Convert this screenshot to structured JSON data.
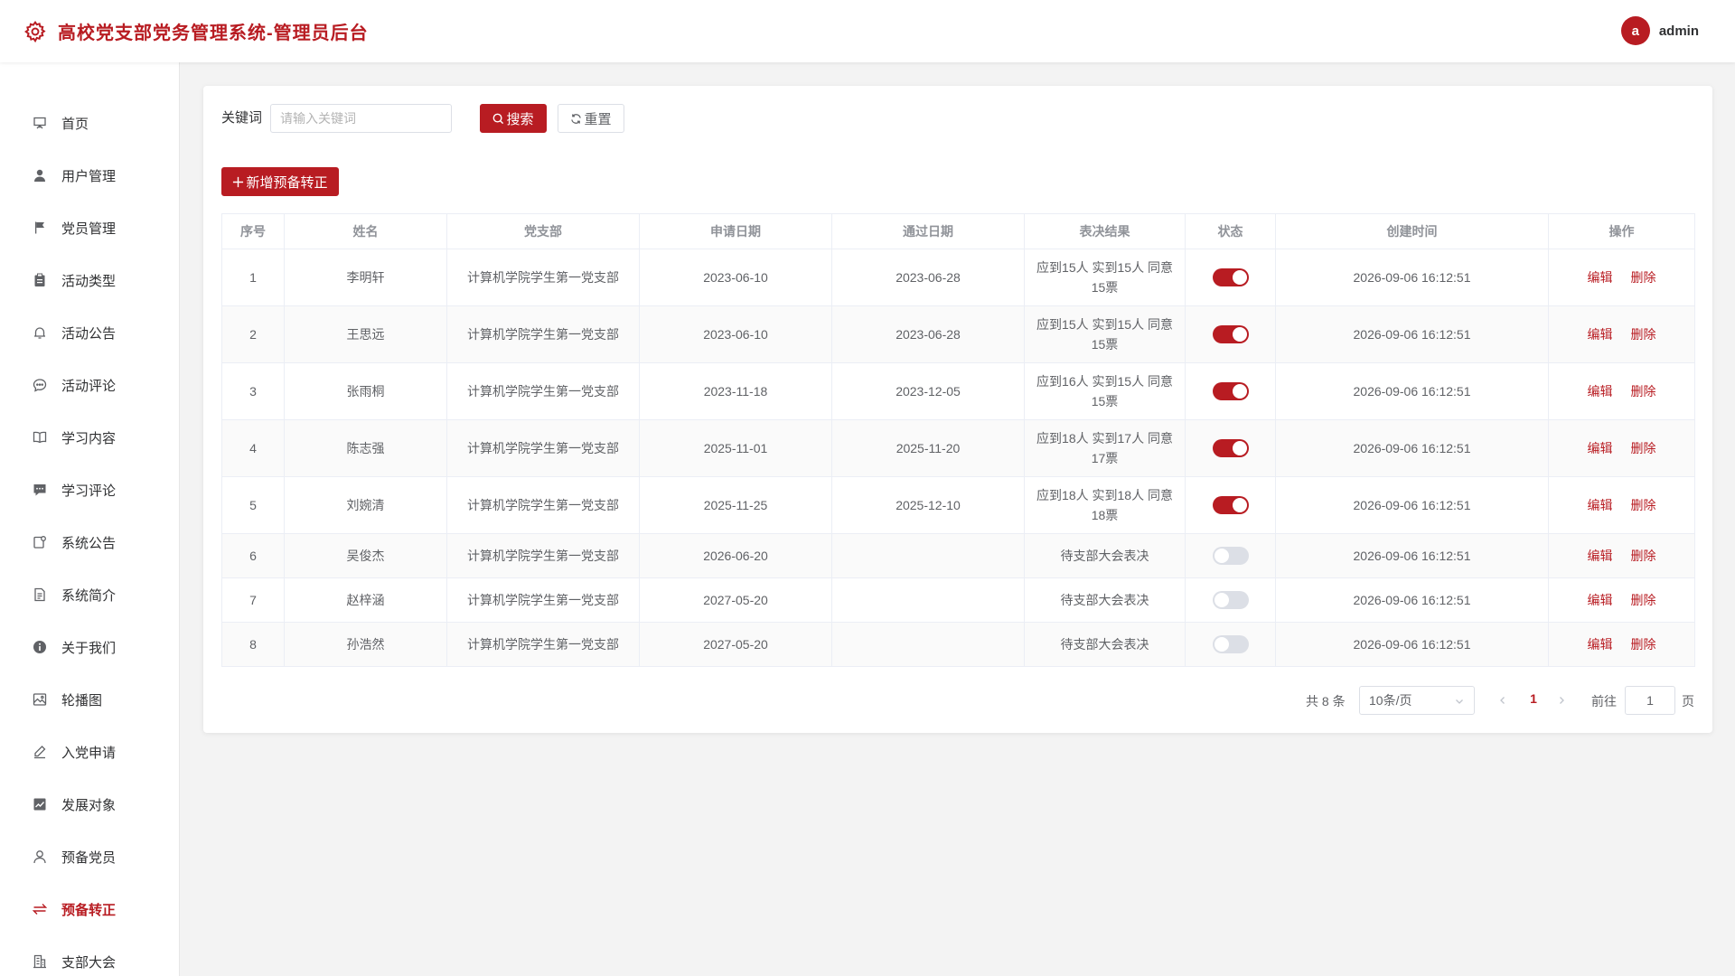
{
  "header": {
    "title": "高校党支部党务管理系统-管理员后台",
    "avatar_letter": "a",
    "username": "admin",
    "brand_color": "#b81c22"
  },
  "sidebar": {
    "items": [
      {
        "label": "首页",
        "icon": "presentation-icon"
      },
      {
        "label": "用户管理",
        "icon": "user-icon"
      },
      {
        "label": "党员管理",
        "icon": "flag-icon"
      },
      {
        "label": "活动类型",
        "icon": "clipboard-icon"
      },
      {
        "label": "活动公告",
        "icon": "bell-icon"
      },
      {
        "label": "活动评论",
        "icon": "chat-dot-icon"
      },
      {
        "label": "学习内容",
        "icon": "book-icon"
      },
      {
        "label": "学习评论",
        "icon": "message-icon"
      },
      {
        "label": "系统公告",
        "icon": "notice-icon"
      },
      {
        "label": "系统简介",
        "icon": "document-icon"
      },
      {
        "label": "关于我们",
        "icon": "info-icon"
      },
      {
        "label": "轮播图",
        "icon": "picture-icon"
      },
      {
        "label": "入党申请",
        "icon": "edit-pen-icon"
      },
      {
        "label": "发展对象",
        "icon": "trend-chart-icon"
      },
      {
        "label": "预备党员",
        "icon": "user-outline-icon"
      },
      {
        "label": "预备转正",
        "icon": "switch-arrows-icon",
        "active": true
      },
      {
        "label": "支部大会",
        "icon": "office-building-icon"
      }
    ]
  },
  "search": {
    "label": "关键词",
    "placeholder": "请输入关键词",
    "value": "",
    "search_button": "搜索",
    "reset_button": "重置"
  },
  "toolbar": {
    "add_button": "新增预备转正"
  },
  "table": {
    "columns": [
      "序号",
      "姓名",
      "党支部",
      "申请日期",
      "通过日期",
      "表决结果",
      "状态",
      "创建时间",
      "操作"
    ],
    "edit_label": "编辑",
    "delete_label": "删除",
    "rows": [
      {
        "no": "1",
        "name": "李明轩",
        "branch": "计算机学院学生第一党支部",
        "apply_date": "2023-06-10",
        "pass_date": "2023-06-28",
        "result": "应到15人 实到15人 同意15票",
        "status": true,
        "created": "2026-09-06 16:12:51"
      },
      {
        "no": "2",
        "name": "王思远",
        "branch": "计算机学院学生第一党支部",
        "apply_date": "2023-06-10",
        "pass_date": "2023-06-28",
        "result": "应到15人 实到15人 同意15票",
        "status": true,
        "created": "2026-09-06 16:12:51"
      },
      {
        "no": "3",
        "name": "张雨桐",
        "branch": "计算机学院学生第一党支部",
        "apply_date": "2023-11-18",
        "pass_date": "2023-12-05",
        "result": "应到16人 实到15人 同意15票",
        "status": true,
        "created": "2026-09-06 16:12:51"
      },
      {
        "no": "4",
        "name": "陈志强",
        "branch": "计算机学院学生第一党支部",
        "apply_date": "2025-11-01",
        "pass_date": "2025-11-20",
        "result": "应到18人 实到17人 同意17票",
        "status": true,
        "created": "2026-09-06 16:12:51"
      },
      {
        "no": "5",
        "name": "刘婉清",
        "branch": "计算机学院学生第一党支部",
        "apply_date": "2025-11-25",
        "pass_date": "2025-12-10",
        "result": "应到18人 实到18人 同意18票",
        "status": true,
        "created": "2026-09-06 16:12:51"
      },
      {
        "no": "6",
        "name": "吴俊杰",
        "branch": "计算机学院学生第一党支部",
        "apply_date": "2026-06-20",
        "pass_date": "",
        "result": "待支部大会表决",
        "status": false,
        "created": "2026-09-06 16:12:51"
      },
      {
        "no": "7",
        "name": "赵梓涵",
        "branch": "计算机学院学生第一党支部",
        "apply_date": "2027-05-20",
        "pass_date": "",
        "result": "待支部大会表决",
        "status": false,
        "created": "2026-09-06 16:12:51"
      },
      {
        "no": "8",
        "name": "孙浩然",
        "branch": "计算机学院学生第一党支部",
        "apply_date": "2027-05-20",
        "pass_date": "",
        "result": "待支部大会表决",
        "status": false,
        "created": "2026-09-06 16:12:51"
      }
    ]
  },
  "pagination": {
    "total_text": "共 8 条",
    "page_size": "10条/页",
    "current_page": "1",
    "goto_label": "前往",
    "goto_value": "1",
    "page_unit": "页"
  }
}
